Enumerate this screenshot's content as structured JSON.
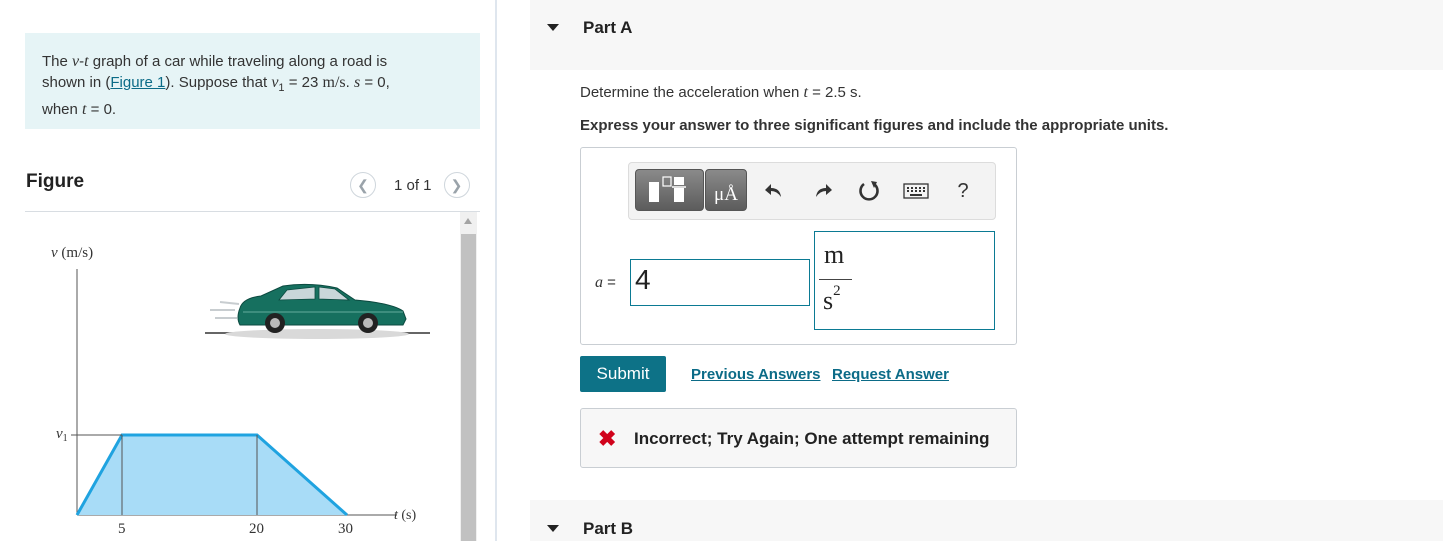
{
  "problem": {
    "p1": "The ",
    "var_v": "v",
    "dash": "-",
    "var_t": "t",
    "p2": " graph of a car while traveling along a road is",
    "p3": "shown in (",
    "figure_link": "Figure 1",
    "p4": "). Suppose that ",
    "var_v1": "v",
    "sub1": "1",
    "p5": " = 23 ",
    "unit_ms": "m/s",
    "p6": ". ",
    "var_s": "s",
    "p7": " = 0,",
    "p8": "when ",
    "var_t2": "t",
    "p9": " = 0."
  },
  "figure": {
    "title": "Figure",
    "pager": "1 of 1",
    "prev_icon": "chevron-left-icon",
    "next_icon": "chevron-right-icon",
    "ylabel_var": "v",
    "ylabel_unit": "(m/s)",
    "y_tick_var": "v",
    "y_tick_sub": "1",
    "xlabel_var": "t",
    "xlabel_unit": "(s)",
    "x_ticks": [
      "5",
      "20",
      "30"
    ],
    "image": "car-illustration",
    "fill_color": "#a8dcf7",
    "line_color": "#1fa3e0"
  },
  "part_a": {
    "title": "Part A",
    "q_prefix": "Determine the acceleration when ",
    "q_var": "t",
    "q_suffix": " = 2.5 s.",
    "instruction": "Express your answer to three significant figures and include the appropriate units.",
    "toolbar": {
      "templates_icon": "templates-icon",
      "units_label": "μÅ",
      "undo_icon": "undo-icon",
      "redo_icon": "redo-icon",
      "reset_icon": "reset-icon",
      "keyboard_icon": "keyboard-icon",
      "help_label": "?"
    },
    "answer_var": "a",
    "answer_eq": " =",
    "answer_value": "4",
    "unit_numerator": "m",
    "unit_denominator": "s",
    "unit_exponent": "2",
    "submit_label": "Submit",
    "previous_answers_label": "Previous Answers",
    "request_answer_label": "Request Answer",
    "feedback_icon": "x-mark-icon",
    "feedback_message": "Incorrect; Try Again; One attempt remaining"
  },
  "part_b": {
    "title": "Part B"
  },
  "colors": {
    "accent": "#0d7287",
    "error": "#d0021b",
    "problem_bg": "#e6f4f6"
  }
}
